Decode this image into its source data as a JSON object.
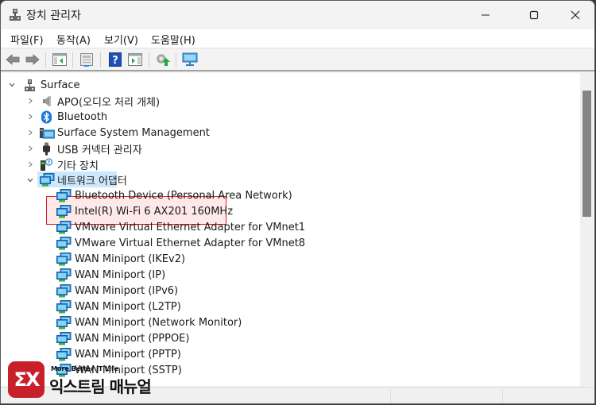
{
  "window": {
    "title": "장치 관리자",
    "title_icon": "device-manager-icon",
    "controls": [
      "minimize",
      "maximize",
      "close"
    ]
  },
  "menu": [
    {
      "label": "파일(F)"
    },
    {
      "label": "동작(A)"
    },
    {
      "label": "보기(V)"
    },
    {
      "label": "도움말(H)"
    }
  ],
  "toolbar": [
    {
      "icon": "back-arrow-icon",
      "tooltip": "back"
    },
    {
      "icon": "forward-arrow-icon",
      "tooltip": "forward"
    },
    {
      "icon": "show-hide-console-tree-icon"
    },
    {
      "icon": "properties-icon"
    },
    {
      "icon": "help-icon"
    },
    {
      "icon": "show-hide-action-pane-icon"
    },
    {
      "icon": "update-driver-icon"
    },
    {
      "icon": "scan-hardware-changes-icon"
    }
  ],
  "tree": {
    "root": {
      "label": "Surface",
      "icon": "computer-icon",
      "expanded": true
    },
    "categories": [
      {
        "label": "APO(오디오 처리 개체)",
        "icon": "speaker-icon",
        "expanded": false
      },
      {
        "label": "Bluetooth",
        "icon": "bluetooth-icon",
        "expanded": false
      },
      {
        "label": "Surface System Management",
        "icon": "system-management-icon",
        "expanded": false
      },
      {
        "label": "USB 커넥터 관리자",
        "icon": "usb-icon",
        "expanded": false
      },
      {
        "label": "기타 장치",
        "icon": "unknown-device-icon",
        "expanded": false
      },
      {
        "label": "네트워크 어댑터",
        "icon": "network-adapter-icon",
        "expanded": true,
        "selected": true
      }
    ],
    "network_adapters": [
      {
        "label": "Bluetooth Device (Personal Area Network)"
      },
      {
        "label": "Intel(R) Wi-Fi 6 AX201 160MHz",
        "highlighted": true
      },
      {
        "label": "VMware Virtual Ethernet Adapter for VMnet1"
      },
      {
        "label": "VMware Virtual Ethernet Adapter for VMnet8"
      },
      {
        "label": "WAN Miniport (IKEv2)"
      },
      {
        "label": "WAN Miniport (IP)"
      },
      {
        "label": "WAN Miniport (IPv6)"
      },
      {
        "label": "WAN Miniport (L2TP)"
      },
      {
        "label": "WAN Miniport (Network Monitor)"
      },
      {
        "label": "WAN Miniport (PPPOE)"
      },
      {
        "label": "WAN Miniport (PPTP)"
      },
      {
        "label": "WAN Miniport (SSTP)"
      }
    ]
  },
  "scrollbar": {
    "position_fraction": 0.0,
    "visible_fraction": 0.4
  },
  "watermark": {
    "logo_text": "ΣX",
    "tagline": "More Better IT Life",
    "name": "익스트림 매뉴얼"
  },
  "colors": {
    "selection": "#cce8ff",
    "highlight_border": "#d9232d",
    "brand_red": "#c8202a"
  }
}
